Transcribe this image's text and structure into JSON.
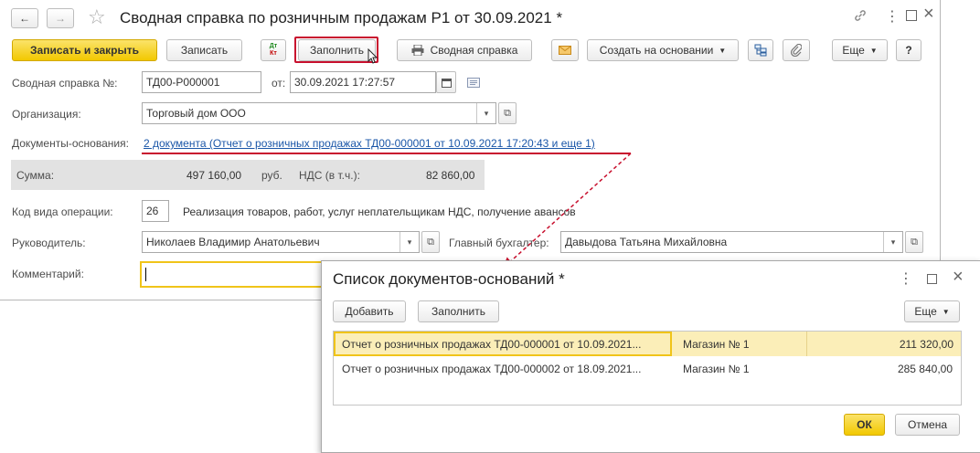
{
  "window": {
    "title": "Сводная справка по розничным продажам Р1 от 30.09.2021 *",
    "nav_back": "←",
    "nav_forward": "→",
    "star": "☆",
    "link": "🔗",
    "menu": "⋮",
    "maximize": "□",
    "close": "×"
  },
  "toolbar": {
    "save_close": "Записать и закрыть",
    "save": "Записать",
    "dt_kt_top": "Дт",
    "dt_kt_bottom": "Кт",
    "fill": "Заполнить",
    "summary": "Сводная справка",
    "create_based": "Создать на основании",
    "more": "Еще",
    "help": "?"
  },
  "form": {
    "number_label": "Сводная справка №:",
    "number_value": "ТД00-Р000001",
    "date_label": "от:",
    "date_value": "30.09.2021 17:27:57",
    "org_label": "Организация:",
    "org_value": "Торговый дом ООО",
    "docs_label": "Документы-основания:",
    "docs_link": "2 документа (Отчет о розничных продажах ТД00-000001 от 10.09.2021 17:20:43 и еще 1)",
    "sum_label": "Сумма:",
    "sum_value": "497 160,00",
    "sum_currency": "руб.",
    "vat_label": "НДС (в т.ч.):",
    "vat_value": "82 860,00",
    "op_label": "Код вида операции:",
    "op_code": "26",
    "op_desc": "Реализация товаров, работ, услуг неплательщикам НДС, получение авансов",
    "head_label": "Руководитель:",
    "head_value": "Николаев Владимир Анатольевич",
    "accountant_label": "Главный бухгалтер:",
    "accountant_value": "Давыдова Татьяна Михайловна",
    "comment_label": "Комментарий:",
    "comment_value": ""
  },
  "dialog": {
    "title": "Список документов-оснований *",
    "add": "Добавить",
    "fill": "Заполнить",
    "more": "Еще",
    "ok": "ОК",
    "cancel": "Отмена",
    "rows": [
      {
        "doc": "Отчет о розничных продажах ТД00-000001 от 10.09.2021...",
        "store": "Магазин № 1",
        "amount": "211 320,00"
      },
      {
        "doc": "Отчет о розничных продажах ТД00-000002 от 18.09.2021...",
        "store": "Магазин № 1",
        "amount": "285 840,00"
      }
    ]
  }
}
